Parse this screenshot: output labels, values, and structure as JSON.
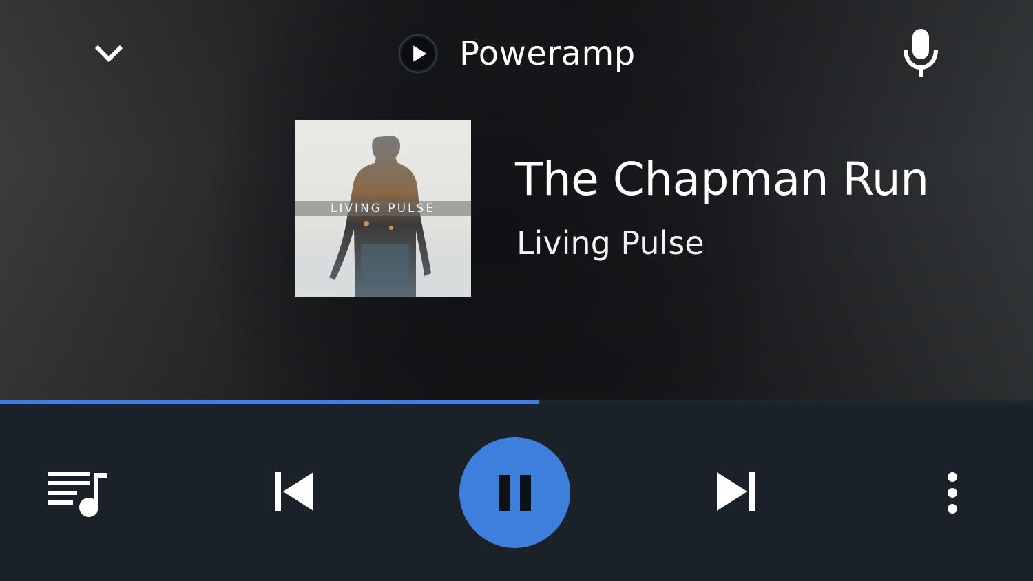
{
  "header": {
    "collapse_icon": "chevron-down-icon",
    "app_icon": "play-circle-icon",
    "app_name": "Poweramp",
    "voice_icon": "microphone-icon"
  },
  "album": {
    "art_text": "LIVING PULSE"
  },
  "track": {
    "title": "The Chapman Run",
    "artist": "Living Pulse"
  },
  "progress": {
    "fraction": 0.521,
    "color": "#3f7fdc"
  },
  "controls": {
    "queue_icon": "queue-music-icon",
    "previous_icon": "skip-previous-icon",
    "play_pause_icon": "pause-icon",
    "next_icon": "skip-next-icon",
    "more_icon": "more-vert-icon",
    "accent_color": "#3f7fdc"
  }
}
